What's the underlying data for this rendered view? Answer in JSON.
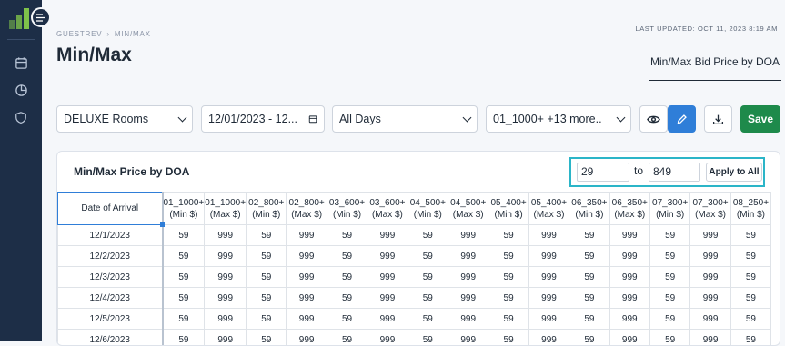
{
  "sidebar": {
    "icons": [
      "calendar-icon",
      "pie-chart-icon",
      "shield-icon"
    ]
  },
  "breadcrumb": {
    "parent": "GUESTREV",
    "current": "MIN/MAX"
  },
  "last_updated": "LAST UPDATED: OCT 11, 2023 8:19 AM",
  "page_title": "Min/Max",
  "tab_label": "Min/Max Bid Price by DOA",
  "filters": {
    "room_type": "DELUXE Rooms",
    "date_range": "12/01/2023 - 12...",
    "days": "All Days",
    "rate_codes": "01_1000+ +13 more.."
  },
  "save_label": "Save",
  "card": {
    "title": "Min/Max Price by DOA",
    "range_min": "29",
    "range_to": "to",
    "range_max": "849",
    "apply_label": "Apply to All"
  },
  "table": {
    "date_header": "Date of Arrival",
    "columns": [
      [
        "01_1000+",
        "(Min $)"
      ],
      [
        "01_1000+",
        "(Max $)"
      ],
      [
        "02_800+",
        "(Min $)"
      ],
      [
        "02_800+",
        "(Max $)"
      ],
      [
        "03_600+",
        "(Min $)"
      ],
      [
        "03_600+",
        "(Max $)"
      ],
      [
        "04_500+",
        "(Min $)"
      ],
      [
        "04_500+",
        "(Max $)"
      ],
      [
        "05_400+",
        "(Min $)"
      ],
      [
        "05_400+",
        "(Max $)"
      ],
      [
        "06_350+",
        "(Min $)"
      ],
      [
        "06_350+",
        "(Max $)"
      ],
      [
        "07_300+",
        "(Min $)"
      ],
      [
        "07_300+",
        "(Max $)"
      ],
      [
        "08_250+",
        "(Min $)"
      ]
    ],
    "rows": [
      {
        "date": "12/1/2023",
        "values": [
          "59",
          "999",
          "59",
          "999",
          "59",
          "999",
          "59",
          "999",
          "59",
          "999",
          "59",
          "999",
          "59",
          "999",
          "59"
        ]
      },
      {
        "date": "12/2/2023",
        "values": [
          "59",
          "999",
          "59",
          "999",
          "59",
          "999",
          "59",
          "999",
          "59",
          "999",
          "59",
          "999",
          "59",
          "999",
          "59"
        ]
      },
      {
        "date": "12/3/2023",
        "values": [
          "59",
          "999",
          "59",
          "999",
          "59",
          "999",
          "59",
          "999",
          "59",
          "999",
          "59",
          "999",
          "59",
          "999",
          "59"
        ]
      },
      {
        "date": "12/4/2023",
        "values": [
          "59",
          "999",
          "59",
          "999",
          "59",
          "999",
          "59",
          "999",
          "59",
          "999",
          "59",
          "999",
          "59",
          "999",
          "59"
        ]
      },
      {
        "date": "12/5/2023",
        "values": [
          "59",
          "999",
          "59",
          "999",
          "59",
          "999",
          "59",
          "999",
          "59",
          "999",
          "59",
          "999",
          "59",
          "999",
          "59"
        ]
      },
      {
        "date": "12/6/2023",
        "values": [
          "59",
          "999",
          "59",
          "999",
          "59",
          "999",
          "59",
          "999",
          "59",
          "999",
          "59",
          "999",
          "59",
          "999",
          "59"
        ]
      }
    ]
  },
  "colors": {
    "sidebar": "#1d2e47",
    "accent_blue": "#2f7ed8",
    "save_green": "#1e8a4b",
    "highlight_teal": "#2bb5c8"
  }
}
